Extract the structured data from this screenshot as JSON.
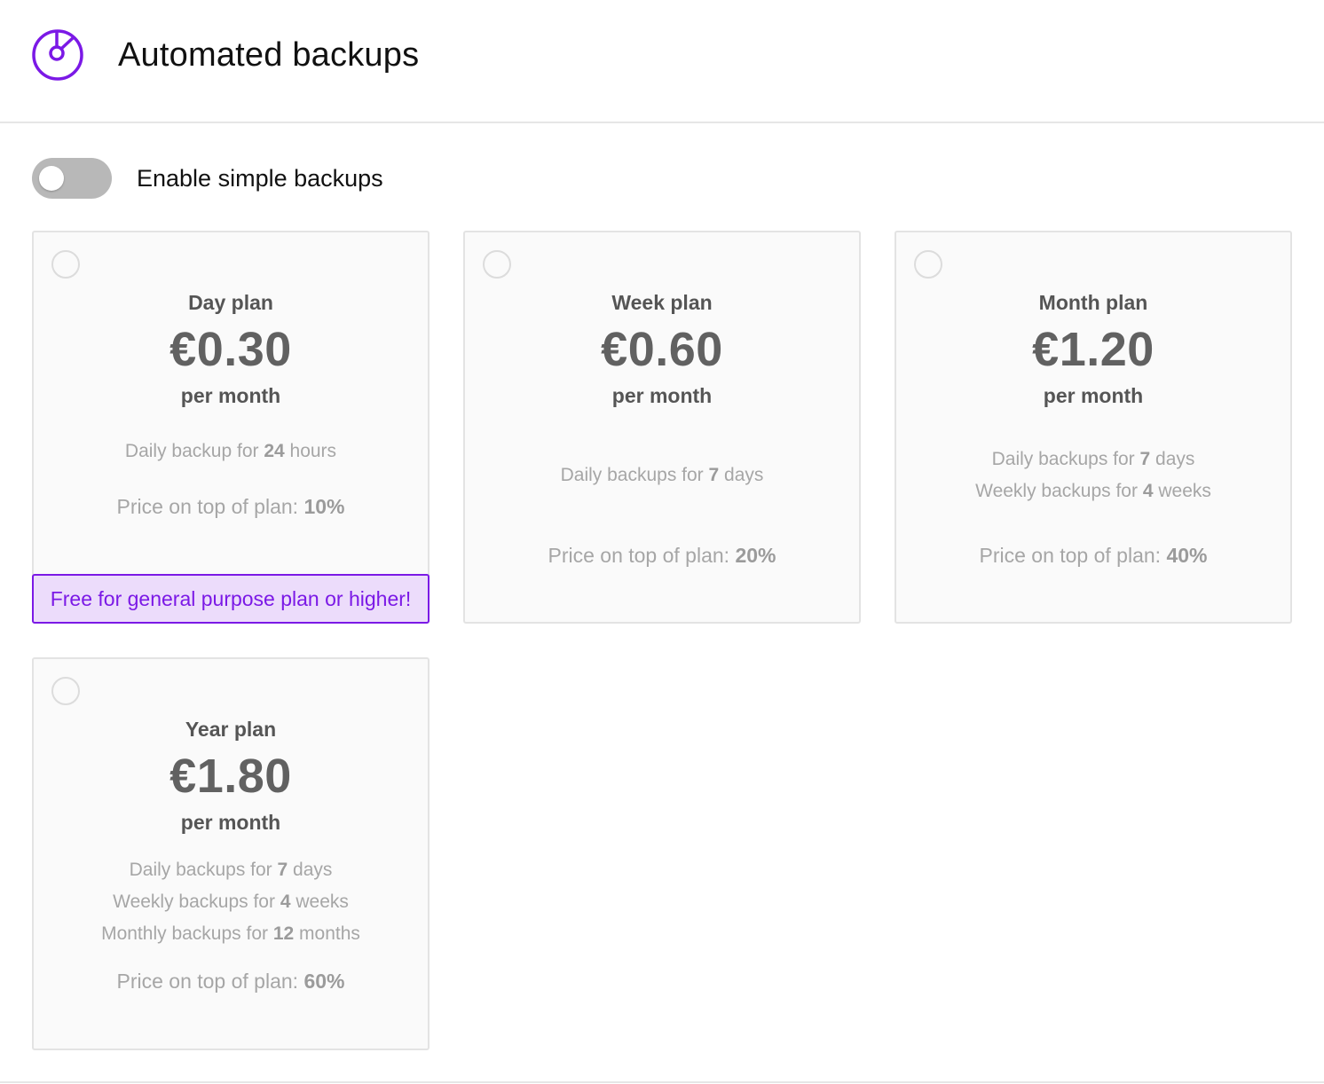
{
  "header": {
    "title": "Automated backups",
    "icon": "backup-dial-icon",
    "accent_color": "#7b19e6"
  },
  "toggle": {
    "label": "Enable simple backups",
    "enabled": false
  },
  "price_prefix": "Price on top of plan: ",
  "plans": [
    {
      "name": "Day plan",
      "price": "€0.30",
      "period": "per month",
      "features": [
        {
          "pre": "Daily backup for ",
          "value": "24",
          "post": " hours"
        }
      ],
      "surcharge": "10%",
      "promo": "Free for general purpose plan or higher!",
      "selected": false
    },
    {
      "name": "Week plan",
      "price": "€0.60",
      "period": "per month",
      "features": [
        {
          "pre": "Daily backups for ",
          "value": "7",
          "post": " days"
        }
      ],
      "surcharge": "20%",
      "selected": false
    },
    {
      "name": "Month plan",
      "price": "€1.20",
      "period": "per month",
      "features": [
        {
          "pre": "Daily backups for ",
          "value": "7",
          "post": " days"
        },
        {
          "pre": "Weekly backups for ",
          "value": "4",
          "post": " weeks"
        }
      ],
      "surcharge": "40%",
      "selected": false
    },
    {
      "name": "Year plan",
      "price": "€1.80",
      "period": "per month",
      "features": [
        {
          "pre": "Daily backups for ",
          "value": "7",
          "post": " days"
        },
        {
          "pre": "Weekly backups for ",
          "value": "4",
          "post": " weeks"
        },
        {
          "pre": "Monthly backups for ",
          "value": "12",
          "post": " months"
        }
      ],
      "surcharge": "60%",
      "selected": false
    }
  ]
}
